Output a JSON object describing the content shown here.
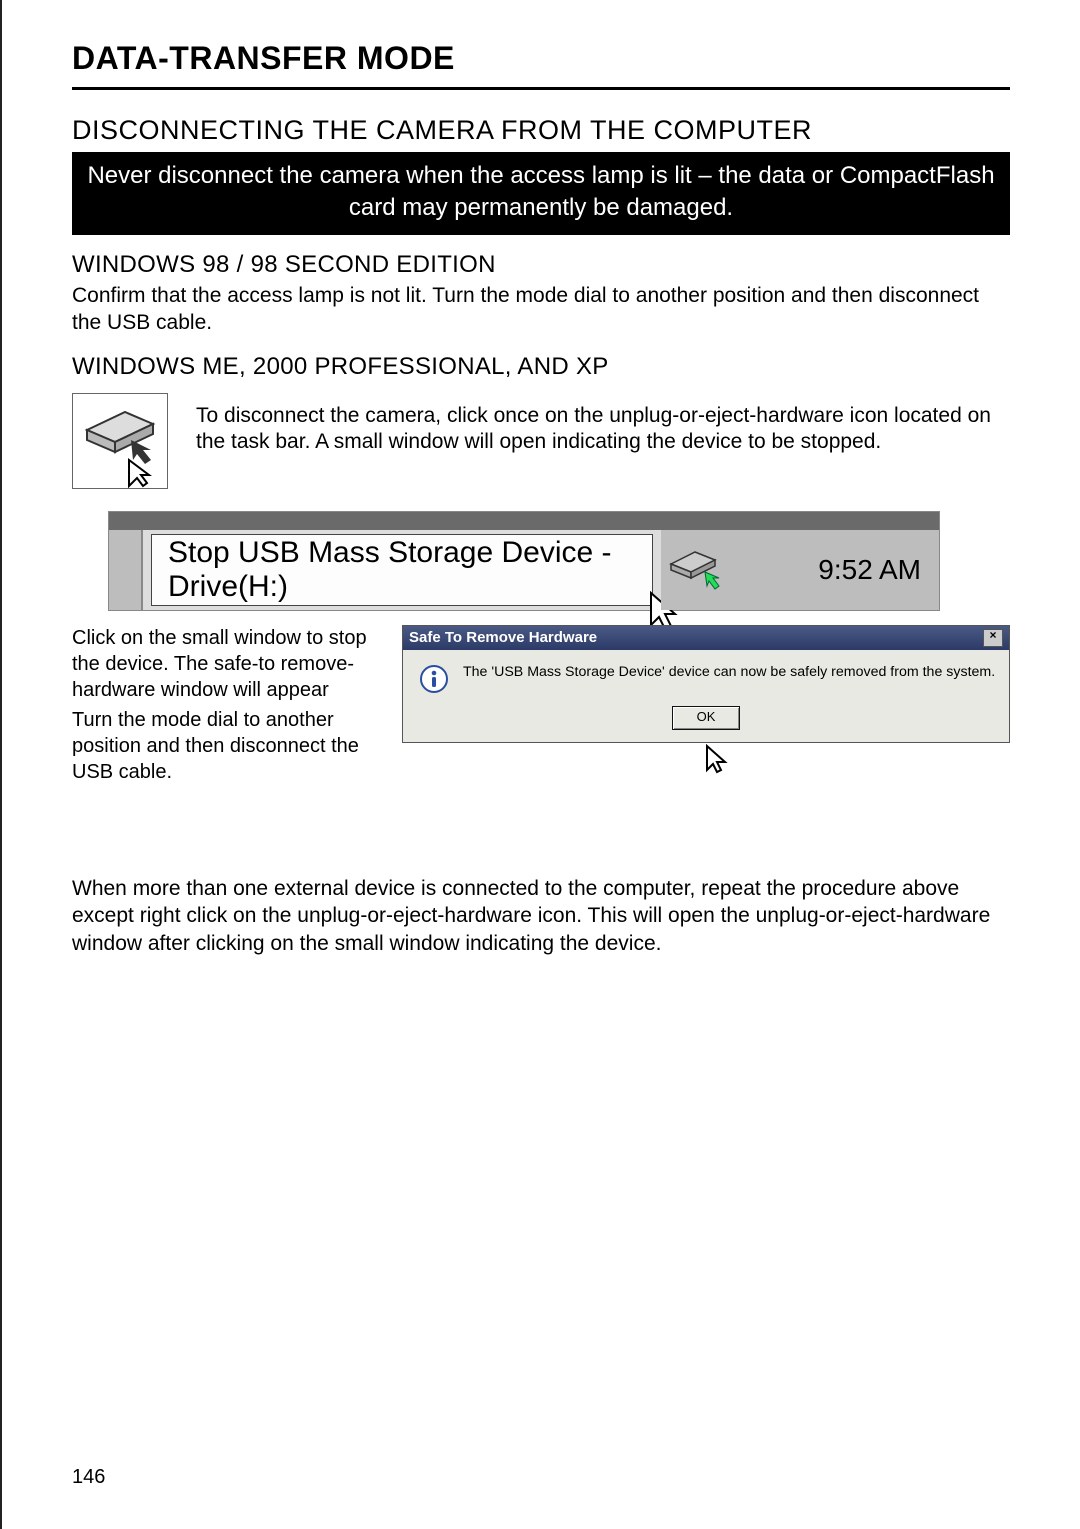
{
  "header": {
    "mode_title": "Data-Transfer Mode"
  },
  "main": {
    "section_title": "DISCONNECTING THE CAMERA FROM THE COMPUTER",
    "warning": "Never disconnect the camera when the access lamp is lit – the data or CompactFlash card may permanently be damaged.",
    "win98": {
      "title": "WINDOWS 98 / 98 SECOND EDITION",
      "body": "Confirm that the access lamp is not lit. Turn the mode dial to another position and then disconnect the USB cable."
    },
    "winme": {
      "title": "WINDOWS ME, 2000 PROFESSIONAL, AND XP",
      "body": "To disconnect the camera, click once on the unplug-or-eject-hardware icon located on the task bar. A small window will open indicating the device to be stopped."
    },
    "systray": {
      "tooltip": "Stop USB Mass Storage Device - Drive(H:)",
      "clock": "9:52 AM"
    },
    "step2": {
      "left_a": "Click on the small window to stop the device. The safe-to remove-hardware window will appear",
      "left_b": "Turn the mode dial to another position and then disconnect the USB cable."
    },
    "dialog": {
      "title": "Safe To Remove Hardware",
      "message": "The 'USB Mass Storage Device' device can now be safely removed from the system.",
      "ok_label": "OK",
      "close_label": "×"
    },
    "footer_note": "When more than one external device is connected to the computer, repeat the procedure above except right click on the unplug-or-eject-hardware icon. This will open the unplug-or-eject-hardware window after clicking on the small window indicating the device."
  },
  "page_number": "146"
}
